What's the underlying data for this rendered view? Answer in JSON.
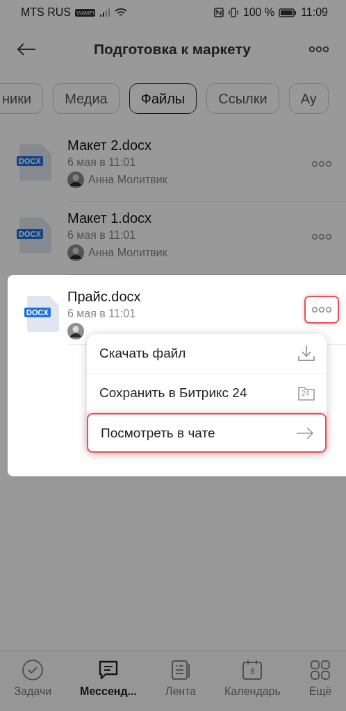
{
  "status_bar": {
    "carrier": "MTS RUS",
    "wifi_badge": "VoWiFi",
    "battery": "100 %",
    "time": "11:09"
  },
  "header": {
    "title": "Подготовка к маркету"
  },
  "tabs": [
    {
      "label": "ники",
      "selected": false
    },
    {
      "label": "Медиа",
      "selected": false
    },
    {
      "label": "Файлы",
      "selected": true
    },
    {
      "label": "Ссылки",
      "selected": false
    },
    {
      "label": "Ау",
      "selected": false
    }
  ],
  "files": [
    {
      "name": "Макет 2.docx",
      "type_label": "DOCX",
      "date": "6 мая в 11:01",
      "author": "Анна Молитвик",
      "focused": false,
      "more_marked": false
    },
    {
      "name": "Макет 1.docx",
      "type_label": "DOCX",
      "date": "6 мая в 11:01",
      "author": "Анна Молитвик",
      "focused": false,
      "more_marked": false
    },
    {
      "name": "Прайс.docx",
      "type_label": "DOCX",
      "date": "6 мая в 11:01",
      "focused": true,
      "more_marked": true
    }
  ],
  "context_menu": {
    "items": [
      {
        "label": "Скачать файл",
        "kind": "download",
        "marked": false
      },
      {
        "label": "Сохранить в Битрикс 24",
        "kind": "folder",
        "icon_text": "24",
        "marked": false
      },
      {
        "label": "Посмотреть в чате",
        "kind": "arrow",
        "marked": true
      }
    ]
  },
  "bottom_nav": [
    {
      "label": "Задачи",
      "kind": "check",
      "selected": false
    },
    {
      "label": "Мессенд...",
      "kind": "chat",
      "selected": true
    },
    {
      "label": "Лента",
      "kind": "feed",
      "selected": false
    },
    {
      "label": "Календарь",
      "kind": "calendar",
      "icon_text": "6",
      "selected": false
    },
    {
      "label": "Ещё",
      "kind": "grid",
      "selected": false
    }
  ]
}
